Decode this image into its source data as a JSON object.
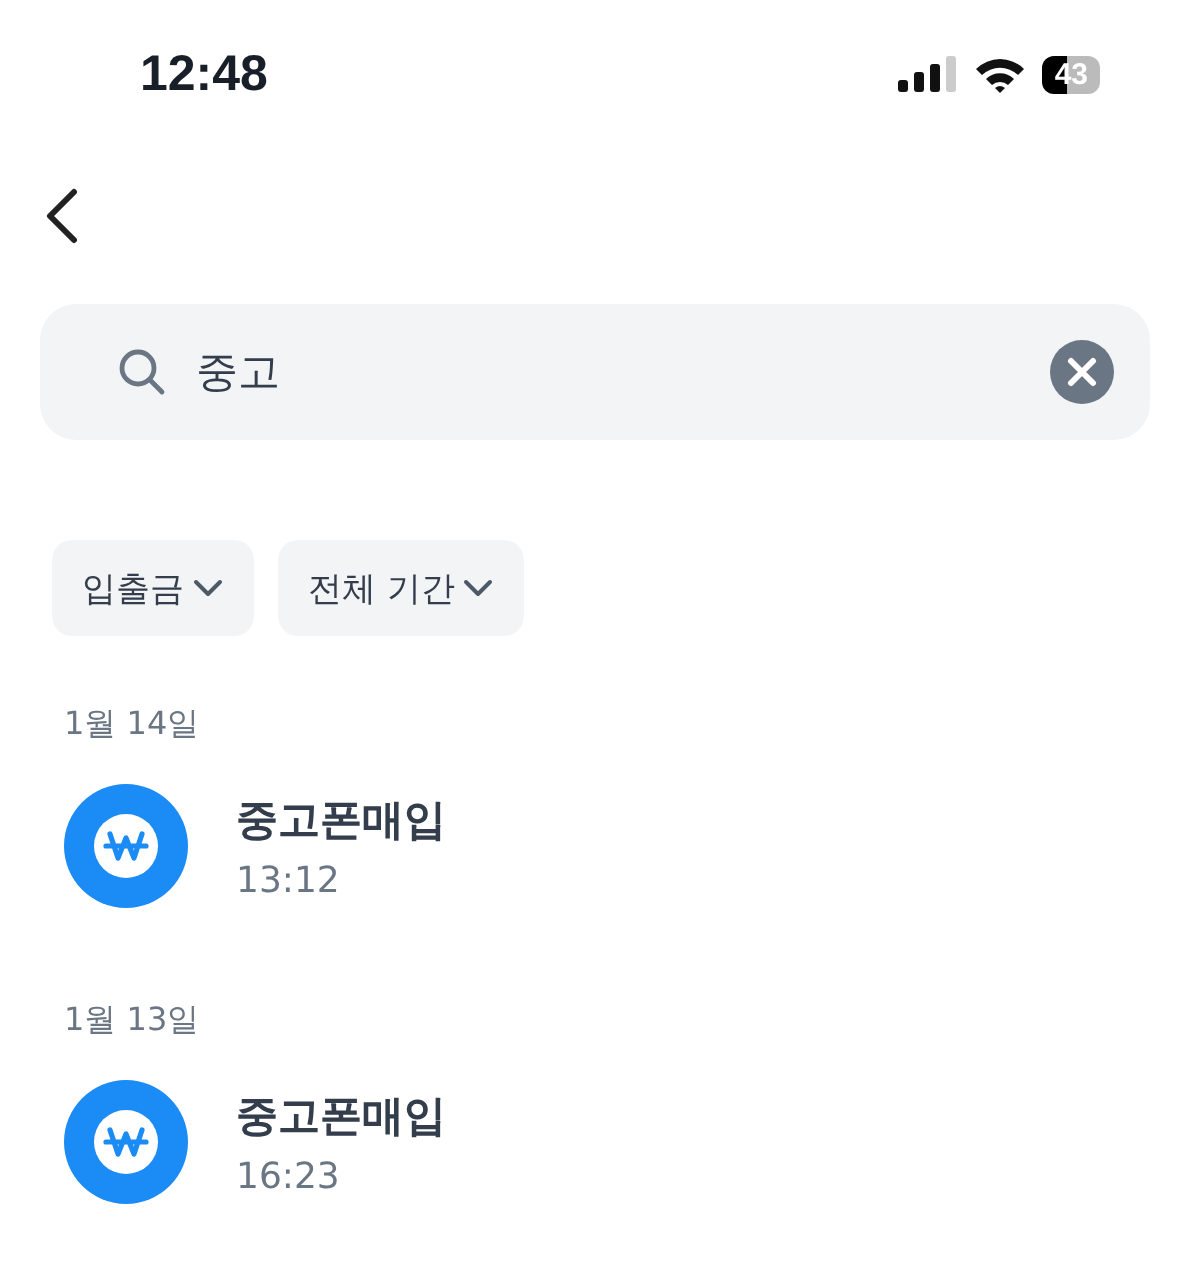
{
  "status_bar": {
    "time": "12:48",
    "battery": "43"
  },
  "search": {
    "value": "중고"
  },
  "filters": [
    {
      "label": "입출금"
    },
    {
      "label": "전체 기간"
    }
  ],
  "groups": [
    {
      "date": "1월 14일",
      "transactions": [
        {
          "title": "중고폰매입",
          "time": "13:12"
        }
      ]
    },
    {
      "date": "1월 13일",
      "transactions": [
        {
          "title": "중고폰매입",
          "time": "16:23"
        }
      ]
    }
  ]
}
